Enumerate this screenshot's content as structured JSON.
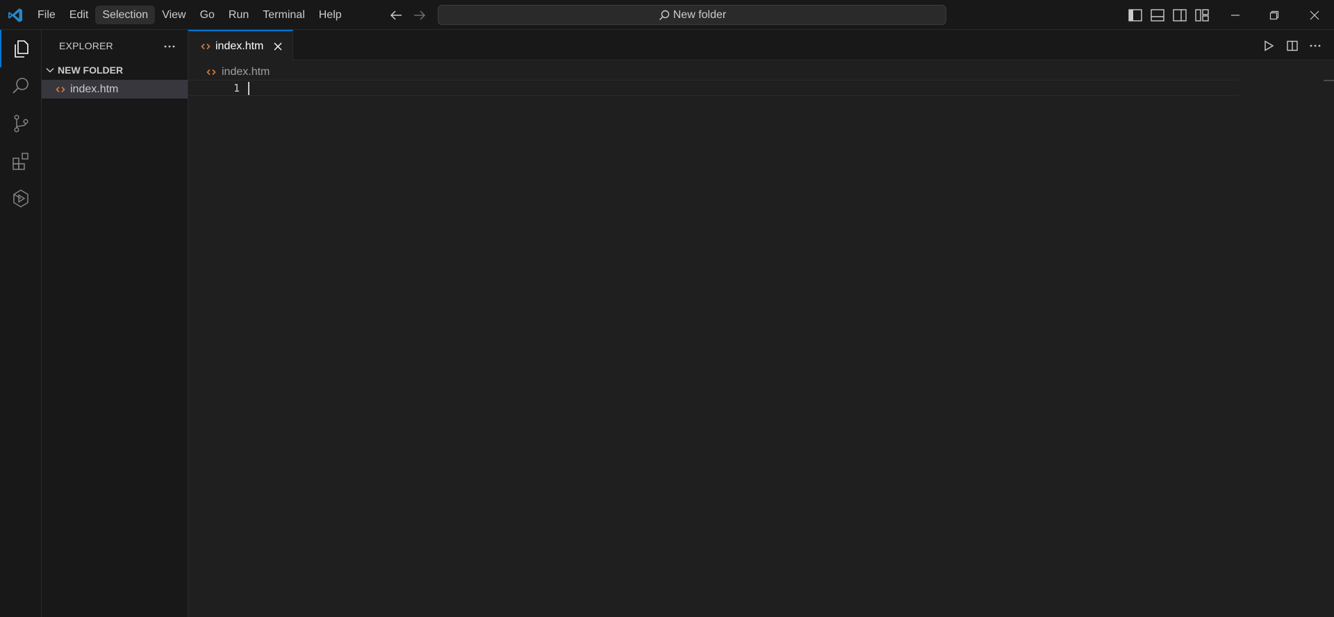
{
  "menu": [
    "File",
    "Edit",
    "Selection",
    "View",
    "Go",
    "Run",
    "Terminal",
    "Help"
  ],
  "menu_active": "Selection",
  "command_center": {
    "text": "New folder"
  },
  "sidebar": {
    "title": "EXPLORER",
    "folder": "NEW FOLDER",
    "files": [
      {
        "name": "index.htm",
        "selected": true
      }
    ]
  },
  "editor": {
    "tab": {
      "label": "index.htm"
    },
    "breadcrumb": "index.htm",
    "lines": [
      {
        "number": "1",
        "text": ""
      }
    ]
  },
  "colors": {
    "accent": "#0078d4",
    "html_icon": "#e37933",
    "background": "#1f1f1f",
    "chrome": "#181818"
  },
  "icons": {
    "activity_bar": [
      "explorer-icon",
      "search-icon",
      "source-control-icon",
      "extensions-icon",
      "remote-explorer-icon"
    ]
  }
}
